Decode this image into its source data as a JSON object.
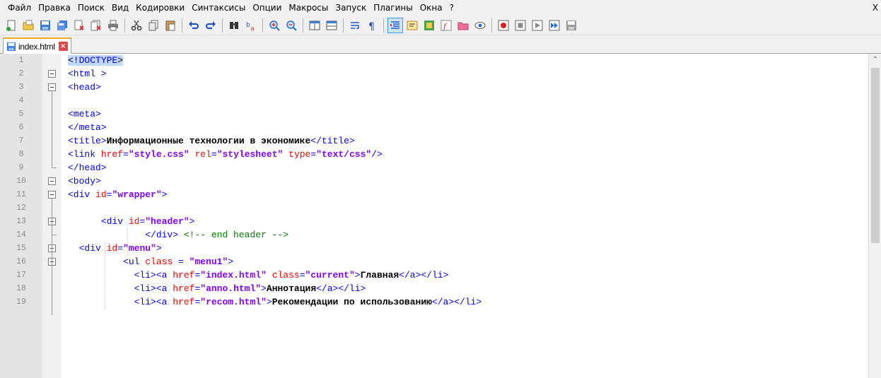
{
  "menu": {
    "items": [
      "Файл",
      "Правка",
      "Поиск",
      "Вид",
      "Кодировки",
      "Синтаксисы",
      "Опции",
      "Макросы",
      "Запуск",
      "Плагины",
      "Окна",
      "?"
    ],
    "close": "X"
  },
  "toolbar": {
    "icons": [
      "new-file-icon",
      "open-file-icon",
      "save-icon",
      "save-all-icon",
      "close-icon",
      "close-all-icon",
      "print-icon",
      "cut-icon",
      "copy-icon",
      "paste-icon",
      "undo-icon",
      "redo-icon",
      "find-icon",
      "replace-icon",
      "zoom-in-icon",
      "zoom-out-icon",
      "sync-vertical-icon",
      "sync-horizontal-icon",
      "word-wrap-icon",
      "show-all-chars-icon",
      "indent-guide-icon",
      "user-language-icon",
      "document-map-icon",
      "function-list-icon",
      "folder-workspace-icon",
      "monitoring-icon",
      "record-macro-icon",
      "stop-macro-icon",
      "play-macro-icon",
      "run-macro-multiple-icon",
      "save-macro-icon"
    ],
    "active_index": 20
  },
  "tab": {
    "label": "index.html",
    "close": "×"
  },
  "editor": {
    "line_numbers": [
      "1",
      "2",
      "3",
      "4",
      "5",
      "6",
      "7",
      "8",
      "9",
      "10",
      "11",
      "12",
      "13",
      "14",
      "15",
      "16",
      "17",
      "18",
      "19"
    ],
    "lines": [
      [
        {
          "c": "doc",
          "t": "<!"
        },
        {
          "c": "doc-b",
          "t": "DOCTYPE"
        },
        {
          "c": "doc",
          "t": ">"
        }
      ],
      [
        {
          "c": "tag",
          "t": "<html >"
        }
      ],
      [
        {
          "c": "tag",
          "t": "<head>"
        }
      ],
      [],
      [
        {
          "c": "tag",
          "t": "<meta>"
        }
      ],
      [
        {
          "c": "tag",
          "t": "</meta>"
        }
      ],
      [
        {
          "c": "tag",
          "t": "<title>"
        },
        {
          "c": "text",
          "t": "Информационные технологии в экономике"
        },
        {
          "c": "tag",
          "t": "</title>"
        }
      ],
      [
        {
          "c": "tag",
          "t": "<link "
        },
        {
          "c": "attr",
          "t": "href"
        },
        {
          "c": "tag",
          "t": "="
        },
        {
          "c": "val",
          "t": "\"style.css\""
        },
        {
          "c": "tag",
          "t": " "
        },
        {
          "c": "attr",
          "t": "rel"
        },
        {
          "c": "tag",
          "t": "="
        },
        {
          "c": "val",
          "t": "\"stylesheet\""
        },
        {
          "c": "tag",
          "t": " "
        },
        {
          "c": "attr",
          "t": "type"
        },
        {
          "c": "tag",
          "t": "="
        },
        {
          "c": "val",
          "t": "\"text/css\""
        },
        {
          "c": "tag",
          "t": "/>"
        }
      ],
      [
        {
          "c": "tag",
          "t": "</head>"
        }
      ],
      [
        {
          "c": "tag",
          "t": "<body>"
        }
      ],
      [
        {
          "c": "tag",
          "t": "<div "
        },
        {
          "c": "attr",
          "t": "id"
        },
        {
          "c": "tag",
          "t": "="
        },
        {
          "c": "val",
          "t": "\"wrapper\""
        },
        {
          "c": "tag",
          "t": ">"
        }
      ],
      [],
      [
        {
          "c": "plain",
          "t": "      "
        },
        {
          "c": "tag",
          "t": "<div "
        },
        {
          "c": "attr",
          "t": "id"
        },
        {
          "c": "tag",
          "t": "="
        },
        {
          "c": "val",
          "t": "\"header\""
        },
        {
          "c": "tag",
          "t": ">"
        }
      ],
      [
        {
          "c": "plain",
          "t": "              "
        },
        {
          "c": "tag",
          "t": "</div>"
        },
        {
          "c": "plain",
          "t": " "
        },
        {
          "c": "com",
          "t": "<!-- end header -->"
        }
      ],
      [
        {
          "c": "plain",
          "t": "  "
        },
        {
          "c": "tag",
          "t": "<div "
        },
        {
          "c": "attr",
          "t": "id"
        },
        {
          "c": "tag",
          "t": "="
        },
        {
          "c": "val",
          "t": "\"menu\""
        },
        {
          "c": "tag",
          "t": ">"
        }
      ],
      [
        {
          "c": "plain",
          "t": "          "
        },
        {
          "c": "tag",
          "t": "<ul "
        },
        {
          "c": "attr",
          "t": "class"
        },
        {
          "c": "tag",
          "t": " = "
        },
        {
          "c": "val",
          "t": "\"menu1\""
        },
        {
          "c": "tag",
          "t": ">"
        }
      ],
      [
        {
          "c": "plain",
          "t": "            "
        },
        {
          "c": "tag",
          "t": "<li><a "
        },
        {
          "c": "attr",
          "t": "href"
        },
        {
          "c": "tag",
          "t": "="
        },
        {
          "c": "val",
          "t": "\"index.html\""
        },
        {
          "c": "tag",
          "t": " "
        },
        {
          "c": "attr",
          "t": "class"
        },
        {
          "c": "tag",
          "t": "="
        },
        {
          "c": "val",
          "t": "\"current\""
        },
        {
          "c": "tag",
          "t": ">"
        },
        {
          "c": "text",
          "t": "Главная"
        },
        {
          "c": "tag",
          "t": "</a></li>"
        }
      ],
      [
        {
          "c": "plain",
          "t": "            "
        },
        {
          "c": "tag",
          "t": "<li><a "
        },
        {
          "c": "attr",
          "t": "href"
        },
        {
          "c": "tag",
          "t": "="
        },
        {
          "c": "val",
          "t": "\"anno.html\""
        },
        {
          "c": "tag",
          "t": ">"
        },
        {
          "c": "text",
          "t": "Аннотация"
        },
        {
          "c": "tag",
          "t": "</a></li>"
        }
      ],
      [
        {
          "c": "plain",
          "t": "            "
        },
        {
          "c": "tag",
          "t": "<li><a "
        },
        {
          "c": "attr",
          "t": "href"
        },
        {
          "c": "tag",
          "t": "="
        },
        {
          "c": "val",
          "t": "\"recom.html\""
        },
        {
          "c": "tag",
          "t": ">"
        },
        {
          "c": "text",
          "t": "Рекомендации по использованию"
        },
        {
          "c": "tag",
          "t": "</a></li>"
        }
      ]
    ]
  }
}
